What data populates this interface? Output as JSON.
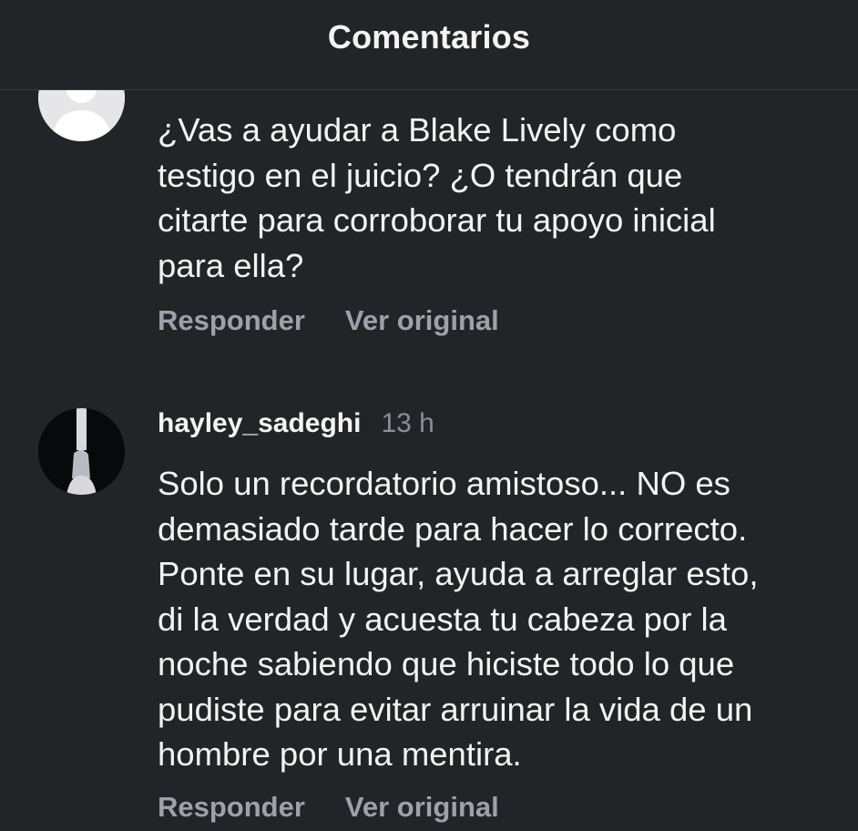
{
  "header": {
    "title": "Comentarios"
  },
  "comments": [
    {
      "avatar": "default-avatar-icon",
      "text": "¿Vas a ayudar a Blake Lively como\ntestigo en el juicio? ¿O tendrán que\ncitarte para corroborar tu apoyo inicial\npara ella?",
      "reply_label": "Responder",
      "original_label": "Ver original"
    },
    {
      "username": "hayley_sadeghi",
      "time": "13 h",
      "avatar": "profile-photo",
      "text": "Solo un recordatorio amistoso... NO es\ndemasiado tarde para hacer lo correcto.\nPonte en su lugar, ayuda a arreglar esto,\ndi la verdad y acuesta tu cabeza por la\nnoche sabiendo que hiciste todo lo que\npudiste para evitar arruinar la vida de un\nhombre por una mentira.",
      "reply_label": "Responder",
      "original_label": "Ver original"
    }
  ],
  "colors": {
    "background": "#232428",
    "primary_text": "#f3f3f3",
    "secondary_text": "#9ea1a8",
    "timestamp": "#8b8e95"
  }
}
